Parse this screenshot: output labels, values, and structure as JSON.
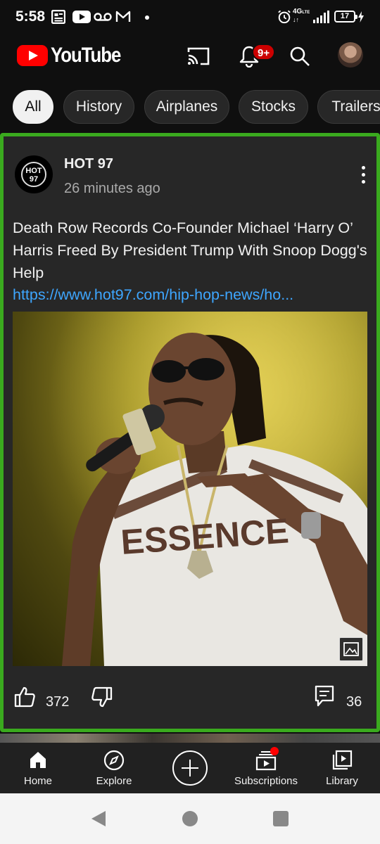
{
  "status_bar": {
    "time": "5:58",
    "network_label": "4G",
    "network_sub": "LTE",
    "battery": "17",
    "icons": [
      "news-icon",
      "youtube-icon",
      "voicemail-icon",
      "gmail-icon",
      "dot-icon",
      "alarm-icon",
      "signal-icon"
    ]
  },
  "app_bar": {
    "logo_text": "YouTube",
    "notification_badge": "9+",
    "icons": [
      "cast-icon",
      "bell-icon",
      "search-icon",
      "avatar"
    ]
  },
  "chips": [
    {
      "label": "All",
      "active": true
    },
    {
      "label": "History",
      "active": false
    },
    {
      "label": "Airplanes",
      "active": false
    },
    {
      "label": "Stocks",
      "active": false
    },
    {
      "label": "Trailers",
      "active": false
    }
  ],
  "post": {
    "channel_avatar_text": "HOT 97",
    "channel_name": "HOT 97",
    "time_ago": "26 minutes ago",
    "text": "Death Row Records Co-Founder Michael ‘Harry O’ Harris Freed By President Trump With Snoop Dogg's Help",
    "link": "https://www.hot97.com/hip-hop-news/ho...",
    "shirt_text": "ESSENCE",
    "likes": "372",
    "comments": "36",
    "accent_border_color": "#3aaa1e",
    "link_color": "#3ea6ff"
  },
  "bottom_nav": [
    {
      "label": "Home",
      "icon": "home-icon"
    },
    {
      "label": "Explore",
      "icon": "compass-icon"
    },
    {
      "label": "",
      "icon": "create-icon"
    },
    {
      "label": "Subscriptions",
      "icon": "subscriptions-icon"
    },
    {
      "label": "Library",
      "icon": "library-icon"
    }
  ],
  "system_nav": [
    "back-icon",
    "home-circle-icon",
    "recents-icon"
  ]
}
